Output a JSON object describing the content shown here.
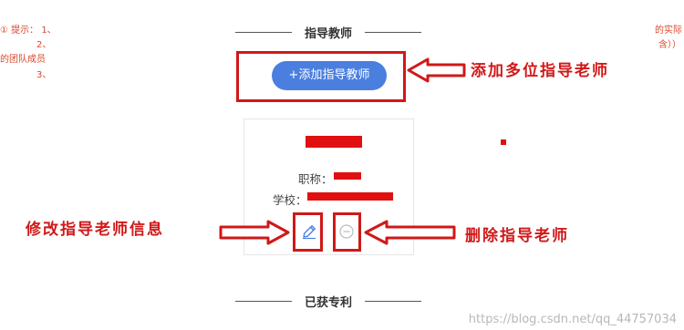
{
  "left_notes": {
    "line1": "① 提示： 1、",
    "line2": "2、",
    "line3": "的团队成员",
    "line4": "3、"
  },
  "right_notes": {
    "line1": "的实际",
    "line2": "含））"
  },
  "section_top": {
    "title": "指导教师"
  },
  "add_button": {
    "label": "+添加指导教师"
  },
  "teacher_card": {
    "title_label": "职称：",
    "school_label": "学校："
  },
  "section_bottom": {
    "title": "已获专利"
  },
  "annotations": {
    "add_note": "添加多位指导老师",
    "edit_note": "修改指导老师信息",
    "delete_note": "删除指导老师"
  },
  "icons": {
    "edit": "pencil-edit-icon",
    "delete": "minus-circle-icon"
  },
  "colors": {
    "accent": "#4a7fe0",
    "annotation_red": "#d01818",
    "note_red": "#d9472b"
  },
  "watermark": "https://blog.csdn.net/qq_44757034"
}
